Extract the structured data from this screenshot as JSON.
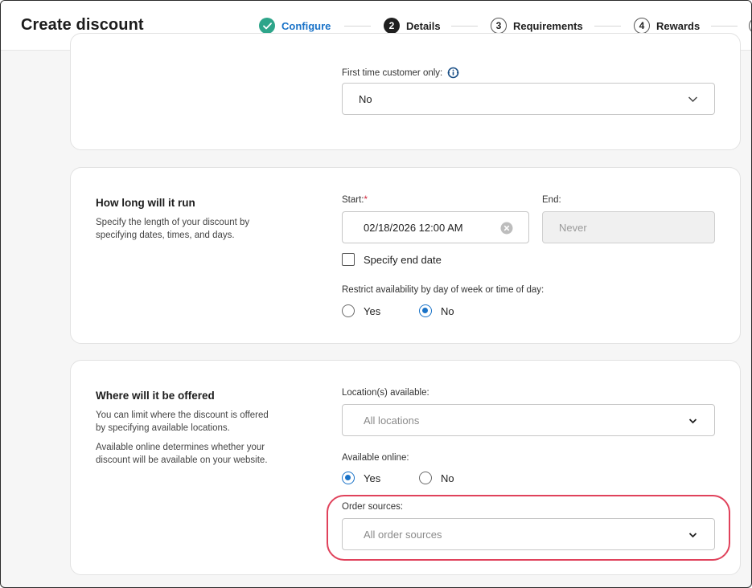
{
  "header": {
    "title": "Create discount",
    "steps": [
      {
        "number": "",
        "label": "Configure",
        "state": "done"
      },
      {
        "number": "2",
        "label": "Details",
        "state": "current"
      },
      {
        "number": "3",
        "label": "Requirements",
        "state": "todo"
      },
      {
        "number": "4",
        "label": "Rewards",
        "state": "todo"
      }
    ]
  },
  "first_time": {
    "label": "First time customer only:",
    "value": "No",
    "info_icon": "info-icon"
  },
  "run": {
    "title": "How long will it run",
    "description": "Specify the length of your discount by specifying dates, times, and days.",
    "start_label": "Start:",
    "required_mark": "*",
    "start_value": "02/18/2026 12:00 AM",
    "end_label": "End:",
    "end_value": "Never",
    "specify_end_label": "Specify end date",
    "restrict_label": "Restrict availability by day of week or time of day:",
    "yes_label": "Yes",
    "no_label": "No",
    "restrict_selected": "No"
  },
  "offered": {
    "title": "Where will it be offered",
    "description_1": "You can limit where the discount is offered by specifying available locations.",
    "description_2": "Available online determines whether your discount will be available on your website.",
    "locations_label": "Location(s) available:",
    "locations_value": "All locations",
    "online_label": "Available online:",
    "yes_label": "Yes",
    "no_label": "No",
    "online_selected": "Yes",
    "sources_label": "Order sources:",
    "sources_value": "All order sources"
  },
  "colors": {
    "accent": "#1a73c8",
    "success": "#2ea58a",
    "highlight": "#e0425b",
    "required": "#d0263b"
  }
}
